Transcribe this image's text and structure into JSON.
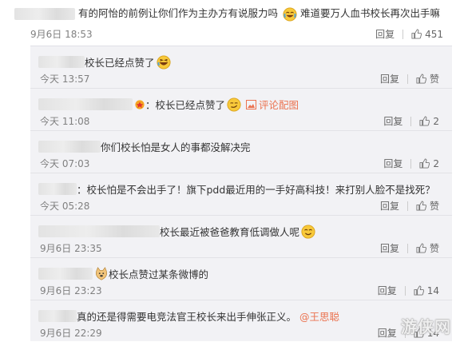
{
  "main_comment": {
    "text_part1": "有的阿怡的前例让你们作为主办方有说服力吗",
    "text_part2": "难道要万人血书校长再次出手嘛",
    "time": "9月6日 18:53",
    "reply_label": "回复",
    "like_count": "451"
  },
  "replies": [
    {
      "text": "校长已经点赞了",
      "time": "今天 13:57",
      "reply_label": "回复",
      "like_label": "赞"
    },
    {
      "text": "：校长已经点赞了",
      "link": "评论配图",
      "time": "今天 11:08",
      "reply_label": "回复",
      "like_count": "2"
    },
    {
      "text": "你们校长怕是女人的事都没解决完",
      "time": "今天 07:03",
      "reply_label": "回复",
      "like_count": "2"
    },
    {
      "text": "：校长怕是不会出手了！旗下pdd最近用的一手好高科技！来打别人脸不是找死？",
      "time": "今天 05:28",
      "reply_label": "回复",
      "like_label": "赞"
    },
    {
      "text": "校长最近被爸爸教育低调做人呢",
      "time": "9月6日 23:35",
      "reply_label": "回复",
      "like_label": "赞"
    },
    {
      "text": "校长点赞过某条微博的",
      "time": "9月6日 23:23",
      "reply_label": "回复",
      "like_count": "14"
    },
    {
      "text": "真的还是得需要电竞法官王校长来出手伸张正义。",
      "mention": "@王思聪",
      "time": "9月6日 22:29",
      "reply_label": "回复",
      "like_count": "14"
    }
  ],
  "watermark": "游侠网",
  "colors": {
    "link": "#eb7350",
    "panel_bg": "#f2f2f5",
    "time": "#808080"
  }
}
